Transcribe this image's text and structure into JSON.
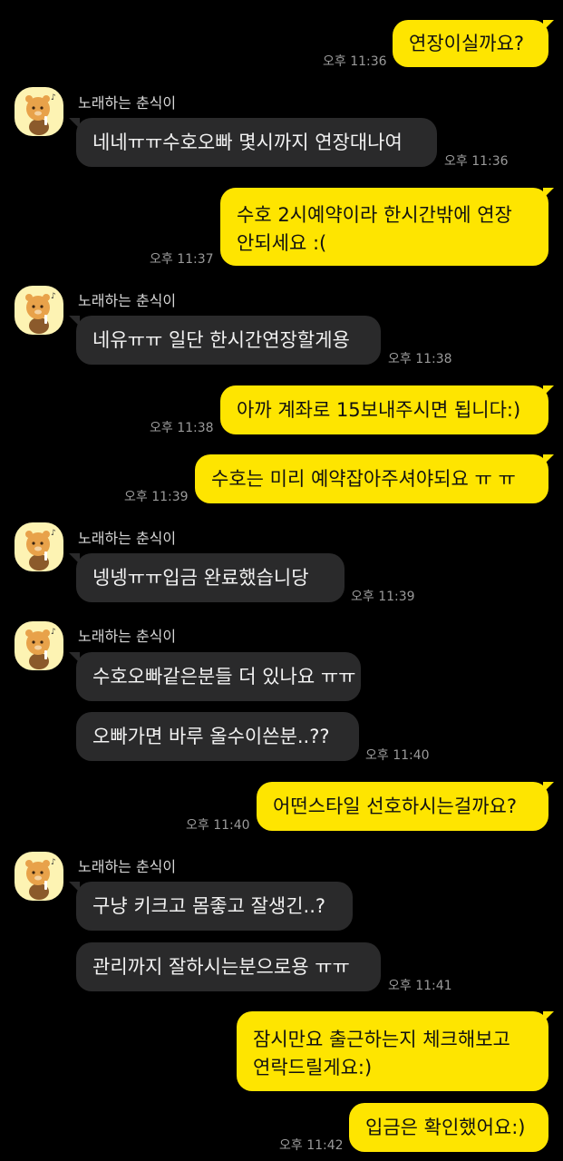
{
  "contact": {
    "name": "노래하는 춘식이",
    "avatar_icon": "choonsik-avatar-icon"
  },
  "colors": {
    "outgoing_bubble": "#FEE500",
    "incoming_bubble": "#2a2a2b",
    "background": "#000000"
  },
  "messages": [
    {
      "text": "연장이실까요?",
      "time": "오후 11:36"
    },
    {
      "text": "네네ㅠㅠ수호오빠 몇시까지 연장대나여",
      "time": "오후 11:36"
    },
    {
      "text": "수호 2시예약이라 한시간밖에 연장 안되세요 :(",
      "time": "오후 11:37"
    },
    {
      "text": "네유ㅠㅠ 일단 한시간연장할게용",
      "time": "오후 11:38"
    },
    {
      "text": "아까 계좌로 15보내주시면 됩니다:)",
      "time": "오후 11:38"
    },
    {
      "text": "수호는 미리 예약잡아주셔야되요 ㅠ ㅠ",
      "time": "오후 11:39"
    },
    {
      "text": "넹넹ㅠㅠ입금 완료했습니당",
      "time": "오후 11:39"
    },
    {
      "text": "수호오빠같은분들 더 있나요 ㅠㅠ",
      "time": ""
    },
    {
      "text": "오빠가면 바루 올수이쓴분..??",
      "time": "오후 11:40"
    },
    {
      "text": "어떤스타일 선호하시는걸까요?",
      "time": "오후 11:40"
    },
    {
      "text": "구냥 키크고 몸좋고 잘생긴..?",
      "time": ""
    },
    {
      "text": "관리까지 잘하시는분으로용 ㅠㅠ",
      "time": "오후 11:41"
    },
    {
      "text": "잠시만요 출근하는지 체크해보고 연락드릴게요:)",
      "time": ""
    },
    {
      "text": "입금은 확인했어요:)",
      "time": "오후 11:42"
    }
  ]
}
